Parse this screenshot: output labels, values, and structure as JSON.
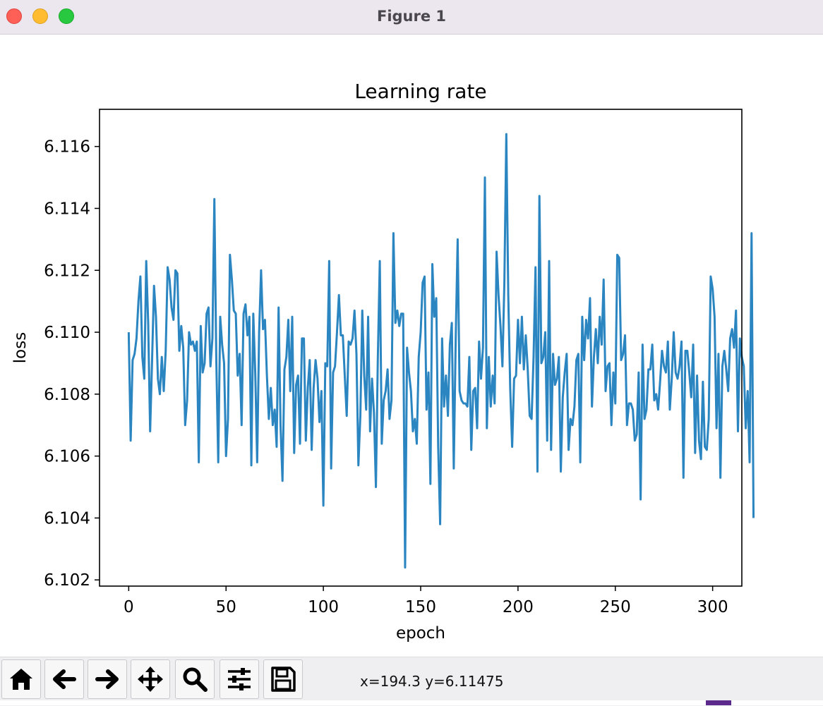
{
  "window": {
    "title": "Figure 1"
  },
  "toolbar": {
    "buttons": [
      {
        "name": "home-button",
        "icon": "home-icon"
      },
      {
        "name": "back-button",
        "icon": "arrow-left-icon"
      },
      {
        "name": "forward-button",
        "icon": "arrow-right-icon"
      },
      {
        "name": "pan-button",
        "icon": "move-icon"
      },
      {
        "name": "zoom-button",
        "icon": "magnifier-icon"
      },
      {
        "name": "configure-subplots-button",
        "icon": "sliders-icon"
      },
      {
        "name": "save-button",
        "icon": "floppy-disk-icon"
      }
    ],
    "coordinates": "x=194.3 y=6.11475"
  },
  "colors": {
    "line": "#2a85c1",
    "axes": "#000000",
    "titlebar": "#ece7ee",
    "toolbar": "#efeef1"
  },
  "chart_data": {
    "type": "line",
    "title": "Learning rate",
    "xlabel": "epoch",
    "ylabel": "loss",
    "xlim": [
      -15,
      315
    ],
    "ylim": [
      6.1018,
      6.1172
    ],
    "xticks": [
      0,
      50,
      100,
      150,
      200,
      250,
      300
    ],
    "xtick_labels": [
      "0",
      "50",
      "100",
      "150",
      "200",
      "250",
      "300"
    ],
    "yticks": [
      6.102,
      6.104,
      6.106,
      6.108,
      6.11,
      6.112,
      6.114,
      6.116
    ],
    "ytick_labels": [
      "6.102",
      "6.104",
      "6.106",
      "6.108",
      "6.110",
      "6.112",
      "6.114",
      "6.116"
    ],
    "grid": false,
    "series": [
      {
        "x_start": 0,
        "x_step": 1,
        "values": [
          6.11,
          6.1065,
          6.1091,
          6.1093,
          6.1098,
          6.111,
          6.1118,
          6.1092,
          6.1085,
          6.1123,
          6.1103,
          6.1068,
          6.1091,
          6.1115,
          6.1105,
          6.1085,
          6.108,
          6.1092,
          6.1081,
          6.1094,
          6.1121,
          6.1117,
          6.1108,
          6.1104,
          6.112,
          6.1119,
          6.1094,
          6.1102,
          6.1095,
          6.107,
          6.1078,
          6.11,
          6.1096,
          6.1097,
          6.1094,
          6.1097,
          6.1058,
          6.1102,
          6.1087,
          6.109,
          6.1106,
          6.1108,
          6.1089,
          6.1098,
          6.1143,
          6.1091,
          6.1058,
          6.1105,
          6.1096,
          6.109,
          6.106,
          6.1072,
          6.1125,
          6.1117,
          6.1107,
          6.1106,
          6.1086,
          6.1093,
          6.107,
          6.1106,
          6.1109,
          6.1099,
          6.1105,
          6.1057,
          6.1106,
          6.1087,
          6.1058,
          6.11,
          6.112,
          6.1101,
          6.1104,
          6.1086,
          6.1072,
          6.1082,
          6.107,
          6.1075,
          6.1063,
          6.1108,
          6.107,
          6.1052,
          6.1088,
          6.1092,
          6.1104,
          6.1081,
          6.1105,
          6.1061,
          6.1083,
          6.1086,
          6.1064,
          6.1098,
          6.1098,
          6.1065,
          6.1082,
          6.1091,
          6.1062,
          6.1082,
          6.1091,
          6.1085,
          6.1071,
          6.1081,
          6.1044,
          6.109,
          6.1089,
          6.1123,
          6.1056,
          6.1087,
          6.1089,
          6.11,
          6.1112,
          6.1099,
          6.1099,
          6.1086,
          6.1073,
          6.1097,
          6.1096,
          6.1098,
          6.1107,
          6.1093,
          6.1057,
          6.1073,
          6.1107,
          6.1086,
          6.1075,
          6.1105,
          6.1068,
          6.1085,
          6.1074,
          6.105,
          6.1092,
          6.1123,
          6.1064,
          6.1078,
          6.1081,
          6.1088,
          6.1072,
          6.1078,
          6.1132,
          6.1103,
          6.1107,
          6.1102,
          6.1106,
          6.1106,
          6.1024,
          6.1095,
          6.1087,
          6.1081,
          6.1068,
          6.1072,
          6.1064,
          6.1092,
          6.11,
          6.1116,
          6.1118,
          6.1075,
          6.1087,
          6.1051,
          6.1122,
          6.1105,
          6.1111,
          6.1063,
          6.1038,
          6.1098,
          6.1076,
          6.1086,
          6.1073,
          6.1096,
          6.1103,
          6.1056,
          6.1098,
          6.113,
          6.1081,
          6.1078,
          6.1077,
          6.1077,
          6.1076,
          6.1092,
          6.1062,
          6.1081,
          6.1082,
          6.1069,
          6.1097,
          6.1085,
          6.1095,
          6.115,
          6.1069,
          6.1092,
          6.1076,
          6.1086,
          6.1077,
          6.1126,
          6.1112,
          6.1102,
          6.1089,
          6.1116,
          6.1164,
          6.1112,
          6.1082,
          6.1063,
          6.1085,
          6.1086,
          6.1104,
          6.109,
          6.1105,
          6.1088,
          6.1099,
          6.1088,
          6.1073,
          6.1072,
          6.1092,
          6.1121,
          6.1055,
          6.1144,
          6.109,
          6.1092,
          6.11,
          6.1065,
          6.1123,
          6.1062,
          6.1093,
          6.1083,
          6.1085,
          6.1092,
          6.1055,
          6.1079,
          6.1087,
          6.1093,
          6.1062,
          6.1072,
          6.107,
          6.1076,
          6.1091,
          6.1093,
          6.1058,
          6.1105,
          6.1091,
          6.1104,
          6.1098,
          6.1111,
          6.1076,
          6.1092,
          6.1101,
          6.109,
          6.1105,
          6.1096,
          6.1117,
          6.1081,
          6.1089,
          6.109,
          6.107,
          6.1087,
          6.1077,
          6.1125,
          6.1124,
          6.1091,
          6.1093,
          6.1099,
          6.107,
          6.1077,
          6.1077,
          6.1075,
          6.1065,
          6.1067,
          6.1087,
          6.1046,
          6.1096,
          6.1072,
          6.1075,
          6.1088,
          6.1088,
          6.1096,
          6.1078,
          6.108,
          6.1075,
          6.1084,
          6.1094,
          6.1089,
          6.1087,
          6.1097,
          6.1075,
          6.1085,
          6.11,
          6.1087,
          6.1085,
          6.1089,
          6.1097,
          6.1053,
          6.1094,
          6.1094,
          6.1087,
          6.1079,
          6.1096,
          6.1061,
          6.1086,
          6.1065,
          6.1059,
          6.1084,
          6.1063,
          6.1062,
          6.1072,
          6.1118,
          6.1114,
          6.1105,
          6.1069,
          6.1093,
          6.1053,
          6.1089,
          6.1094,
          6.1088,
          6.1081,
          6.1098,
          6.1101,
          6.1095,
          6.1107,
          6.1068,
          6.1098,
          6.1092,
          6.1089,
          6.1069,
          6.1081,
          6.1058,
          6.1132,
          6.104
        ]
      }
    ]
  }
}
